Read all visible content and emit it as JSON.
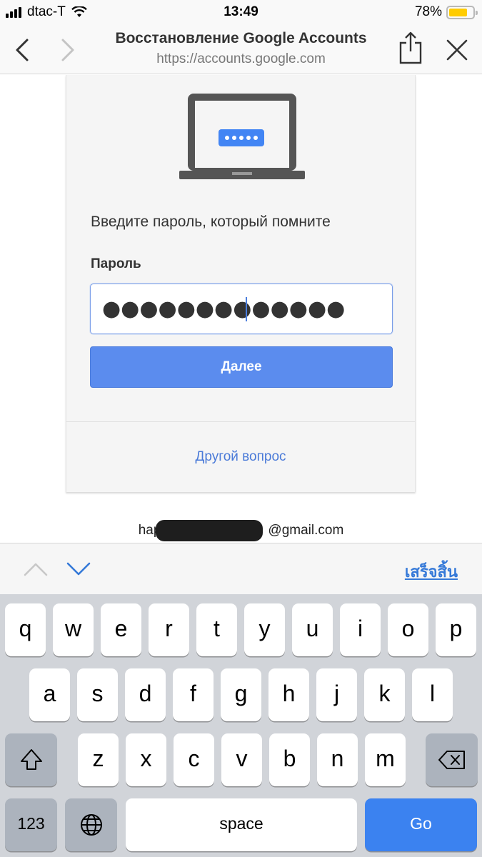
{
  "status_bar": {
    "carrier": "dtac-T",
    "time": "13:49",
    "battery_percent": "78%",
    "battery_level": 0.78
  },
  "nav": {
    "title": "Восстановление Google Accounts",
    "url": "https://accounts.google.com"
  },
  "page": {
    "prompt": "Введите пароль, который помните",
    "password_label": "Пароль",
    "password_value": "●●●●●●●●●●●●●",
    "next_button": "Далее",
    "other_question_link": "Другой вопрос",
    "email_prefix": "hap",
    "email_suffix": "@gmail.com"
  },
  "accessory": {
    "done_label": "เสร็จสิ้น"
  },
  "keyboard": {
    "row1": [
      "q",
      "w",
      "e",
      "r",
      "t",
      "y",
      "u",
      "i",
      "o",
      "p"
    ],
    "row2": [
      "a",
      "s",
      "d",
      "f",
      "g",
      "h",
      "j",
      "k",
      "l"
    ],
    "row3": [
      "z",
      "x",
      "c",
      "v",
      "b",
      "n",
      "m"
    ],
    "numbers_key": "123",
    "space_key": "space",
    "go_key": "Go"
  },
  "colors": {
    "accent_blue": "#5b8cee",
    "link_blue": "#4a7ad8",
    "go_key_blue": "#3b82f0",
    "battery_yellow": "#ffcc00"
  },
  "icons": [
    "back-chevron-icon",
    "forward-chevron-icon",
    "share-icon",
    "close-icon",
    "laptop-password-icon",
    "chevron-up-icon",
    "chevron-down-icon",
    "shift-icon",
    "globe-icon",
    "delete-icon",
    "wifi-icon",
    "signal-icon",
    "battery-icon"
  ]
}
